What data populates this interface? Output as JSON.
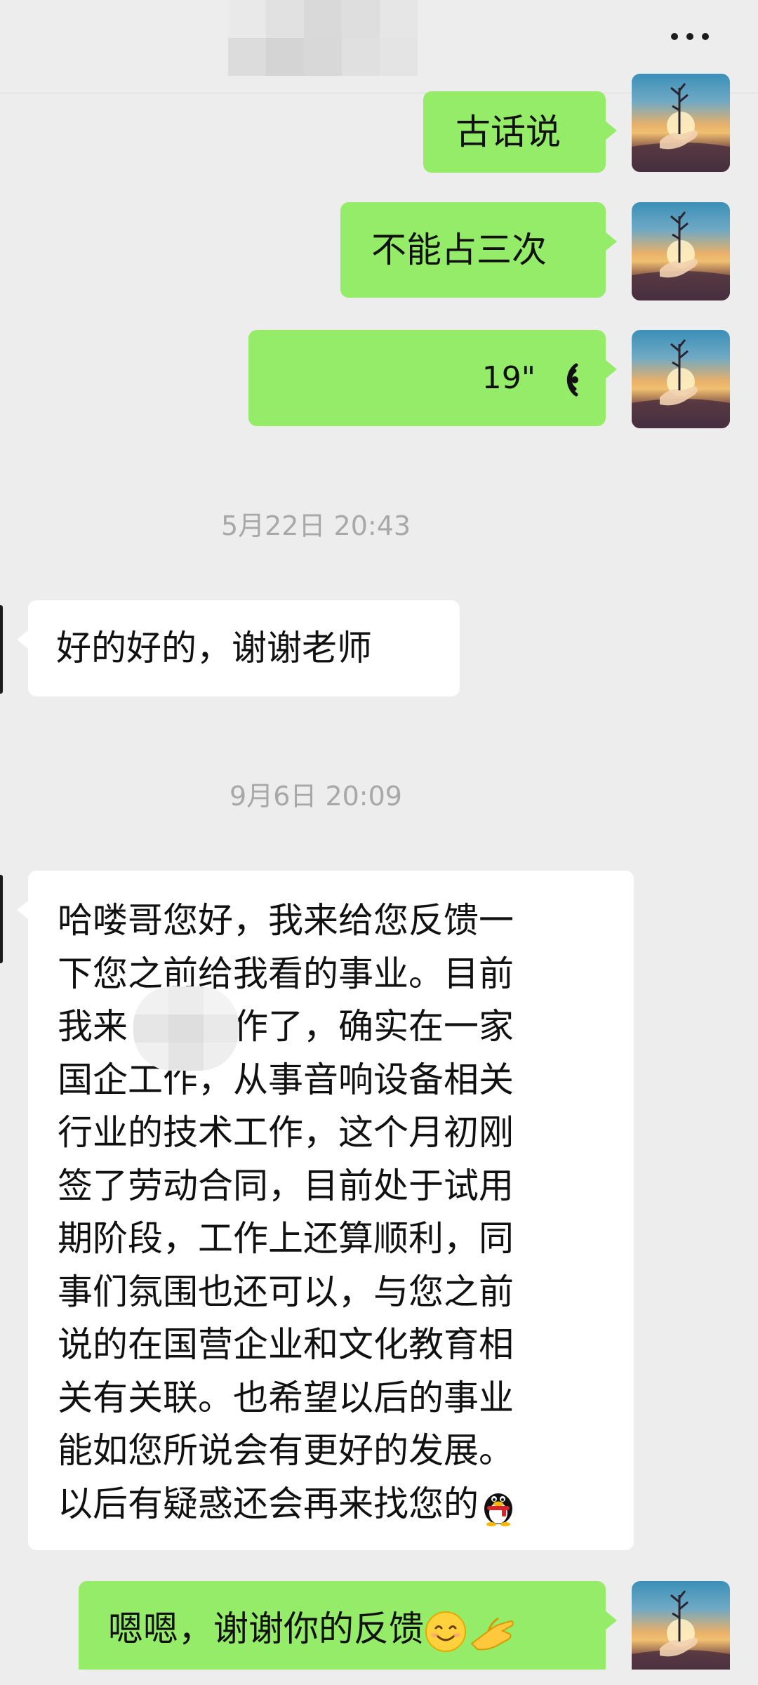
{
  "header": {
    "contact_name_obscured": true,
    "more_icon": "more-dots-icon"
  },
  "messages": [
    {
      "side": "out",
      "type": "text",
      "text": "古话说"
    },
    {
      "side": "out",
      "type": "text",
      "text": "不能占三次"
    },
    {
      "side": "out",
      "type": "voice",
      "duration": "19\"",
      "icon": "voice-wave-icon"
    },
    {
      "type": "timestamp",
      "text": "5月22日 20:43"
    },
    {
      "side": "in",
      "type": "text",
      "text": "好的好的，谢谢老师"
    },
    {
      "type": "timestamp",
      "text": "9月6日 20:09"
    },
    {
      "side": "in",
      "type": "text",
      "lines": [
        "哈喽哥您好，我来给您反馈一",
        "下您之前给我看的事业。目前",
        "我来　　工作了，确实在一家",
        "国企工作，从事音响设备相关",
        "行业的技术工作，这个月初刚",
        "签了劳动合同，目前处于试用",
        "期阶段，工作上还算顺利，同",
        "事们氛围也还可以，与您之前",
        "说的在国营企业和文化教育相",
        "关有关联。也希望以后的事业",
        "能如您所说会有更好的发展。",
        "以后有疑惑还会再来找您的"
      ],
      "trailing_emoji": "qq-penguin-emoji"
    },
    {
      "side": "out",
      "type": "text",
      "text": "嗯嗯，谢谢你的反馈",
      "trailing_emojis": [
        "smile-emoji",
        "ok-hand-emoji"
      ]
    }
  ],
  "colors": {
    "background": "#ededed",
    "outgoing_bubble": "#95ec69",
    "incoming_bubble": "#ffffff",
    "timestamp": "#a8a8a8"
  }
}
